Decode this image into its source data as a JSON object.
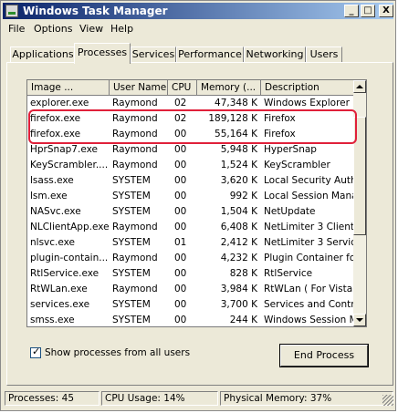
{
  "window": {
    "title": "Windows Task Manager",
    "buttons": [
      "_",
      "□",
      "X"
    ]
  },
  "menu": {
    "items": [
      "File",
      "Options",
      "View",
      "Help"
    ]
  },
  "tabs": [
    {
      "label": "Applications",
      "active": false
    },
    {
      "label": "Processes",
      "active": true
    },
    {
      "label": "Services",
      "active": false
    },
    {
      "label": "Performance",
      "active": false
    },
    {
      "label": "Networking",
      "active": false
    },
    {
      "label": "Users",
      "active": false
    }
  ],
  "table": {
    "columns": [
      "Image ...",
      "User Name",
      "CPU",
      "Memory (...",
      "Description"
    ],
    "rows": [
      [
        "explorer.exe",
        "Raymond",
        "02",
        "47,348 K",
        "Windows Explorer"
      ],
      [
        "firefox.exe",
        "Raymond",
        "02",
        "189,128 K",
        "Firefox"
      ],
      [
        "firefox.exe",
        "Raymond",
        "00",
        "55,164 K",
        "Firefox"
      ],
      [
        "HprSnap7.exe",
        "Raymond",
        "00",
        "5,948 K",
        "HyperSnap"
      ],
      [
        "KeyScrambler....",
        "Raymond",
        "00",
        "1,524 K",
        "KeyScrambler"
      ],
      [
        "lsass.exe",
        "SYSTEM",
        "00",
        "3,620 K",
        "Local Security Autho"
      ],
      [
        "lsm.exe",
        "SYSTEM",
        "00",
        "992 K",
        "Local Session Manag"
      ],
      [
        "NASvc.exe",
        "SYSTEM",
        "00",
        "1,504 K",
        "NetUpdate"
      ],
      [
        "NLClientApp.exe",
        "Raymond",
        "00",
        "6,408 K",
        "NetLimiter 3 Client"
      ],
      [
        "nlsvc.exe",
        "SYSTEM",
        "01",
        "2,412 K",
        "NetLimiter 3 Service"
      ],
      [
        "plugin-contain...",
        "Raymond",
        "00",
        "4,232 K",
        "Plugin Container for"
      ],
      [
        "RtlService.exe",
        "SYSTEM",
        "00",
        "828 K",
        "RtlService"
      ],
      [
        "RtWLan.exe",
        "Raymond",
        "00",
        "3,984 K",
        "RtWLan ( For Vista )"
      ],
      [
        "services.exe",
        "SYSTEM",
        "00",
        "3,700 K",
        "Services and Contro"
      ],
      [
        "smss.exe",
        "SYSTEM",
        "00",
        "244 K",
        "Windows Session M"
      ]
    ]
  },
  "show_all_processes": {
    "label": "Show processes from all users",
    "checked": true
  },
  "end_process_label": "End Process",
  "status": {
    "processes": "Processes: 45",
    "cpu": "CPU Usage: 14%",
    "memory": "Physical Memory: 37%"
  },
  "colors": {
    "highlight": "#e0203a",
    "title_start": "#0a246a",
    "title_end": "#a6caf0",
    "face": "#ece9d8"
  }
}
